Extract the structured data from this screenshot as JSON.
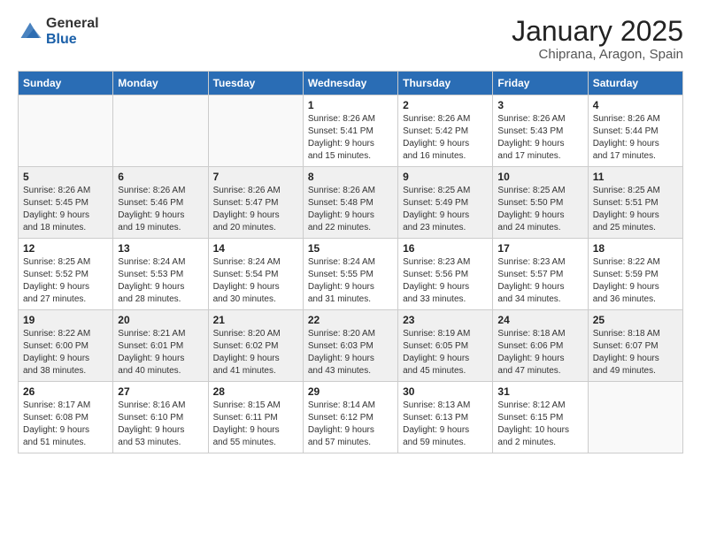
{
  "logo": {
    "general": "General",
    "blue": "Blue"
  },
  "header": {
    "month": "January 2025",
    "location": "Chiprana, Aragon, Spain"
  },
  "weekdays": [
    "Sunday",
    "Monday",
    "Tuesday",
    "Wednesday",
    "Thursday",
    "Friday",
    "Saturday"
  ],
  "weeks": [
    [
      {
        "day": "",
        "info": ""
      },
      {
        "day": "",
        "info": ""
      },
      {
        "day": "",
        "info": ""
      },
      {
        "day": "1",
        "info": "Sunrise: 8:26 AM\nSunset: 5:41 PM\nDaylight: 9 hours\nand 15 minutes."
      },
      {
        "day": "2",
        "info": "Sunrise: 8:26 AM\nSunset: 5:42 PM\nDaylight: 9 hours\nand 16 minutes."
      },
      {
        "day": "3",
        "info": "Sunrise: 8:26 AM\nSunset: 5:43 PM\nDaylight: 9 hours\nand 17 minutes."
      },
      {
        "day": "4",
        "info": "Sunrise: 8:26 AM\nSunset: 5:44 PM\nDaylight: 9 hours\nand 17 minutes."
      }
    ],
    [
      {
        "day": "5",
        "info": "Sunrise: 8:26 AM\nSunset: 5:45 PM\nDaylight: 9 hours\nand 18 minutes."
      },
      {
        "day": "6",
        "info": "Sunrise: 8:26 AM\nSunset: 5:46 PM\nDaylight: 9 hours\nand 19 minutes."
      },
      {
        "day": "7",
        "info": "Sunrise: 8:26 AM\nSunset: 5:47 PM\nDaylight: 9 hours\nand 20 minutes."
      },
      {
        "day": "8",
        "info": "Sunrise: 8:26 AM\nSunset: 5:48 PM\nDaylight: 9 hours\nand 22 minutes."
      },
      {
        "day": "9",
        "info": "Sunrise: 8:25 AM\nSunset: 5:49 PM\nDaylight: 9 hours\nand 23 minutes."
      },
      {
        "day": "10",
        "info": "Sunrise: 8:25 AM\nSunset: 5:50 PM\nDaylight: 9 hours\nand 24 minutes."
      },
      {
        "day": "11",
        "info": "Sunrise: 8:25 AM\nSunset: 5:51 PM\nDaylight: 9 hours\nand 25 minutes."
      }
    ],
    [
      {
        "day": "12",
        "info": "Sunrise: 8:25 AM\nSunset: 5:52 PM\nDaylight: 9 hours\nand 27 minutes."
      },
      {
        "day": "13",
        "info": "Sunrise: 8:24 AM\nSunset: 5:53 PM\nDaylight: 9 hours\nand 28 minutes."
      },
      {
        "day": "14",
        "info": "Sunrise: 8:24 AM\nSunset: 5:54 PM\nDaylight: 9 hours\nand 30 minutes."
      },
      {
        "day": "15",
        "info": "Sunrise: 8:24 AM\nSunset: 5:55 PM\nDaylight: 9 hours\nand 31 minutes."
      },
      {
        "day": "16",
        "info": "Sunrise: 8:23 AM\nSunset: 5:56 PM\nDaylight: 9 hours\nand 33 minutes."
      },
      {
        "day": "17",
        "info": "Sunrise: 8:23 AM\nSunset: 5:57 PM\nDaylight: 9 hours\nand 34 minutes."
      },
      {
        "day": "18",
        "info": "Sunrise: 8:22 AM\nSunset: 5:59 PM\nDaylight: 9 hours\nand 36 minutes."
      }
    ],
    [
      {
        "day": "19",
        "info": "Sunrise: 8:22 AM\nSunset: 6:00 PM\nDaylight: 9 hours\nand 38 minutes."
      },
      {
        "day": "20",
        "info": "Sunrise: 8:21 AM\nSunset: 6:01 PM\nDaylight: 9 hours\nand 40 minutes."
      },
      {
        "day": "21",
        "info": "Sunrise: 8:20 AM\nSunset: 6:02 PM\nDaylight: 9 hours\nand 41 minutes."
      },
      {
        "day": "22",
        "info": "Sunrise: 8:20 AM\nSunset: 6:03 PM\nDaylight: 9 hours\nand 43 minutes."
      },
      {
        "day": "23",
        "info": "Sunrise: 8:19 AM\nSunset: 6:05 PM\nDaylight: 9 hours\nand 45 minutes."
      },
      {
        "day": "24",
        "info": "Sunrise: 8:18 AM\nSunset: 6:06 PM\nDaylight: 9 hours\nand 47 minutes."
      },
      {
        "day": "25",
        "info": "Sunrise: 8:18 AM\nSunset: 6:07 PM\nDaylight: 9 hours\nand 49 minutes."
      }
    ],
    [
      {
        "day": "26",
        "info": "Sunrise: 8:17 AM\nSunset: 6:08 PM\nDaylight: 9 hours\nand 51 minutes."
      },
      {
        "day": "27",
        "info": "Sunrise: 8:16 AM\nSunset: 6:10 PM\nDaylight: 9 hours\nand 53 minutes."
      },
      {
        "day": "28",
        "info": "Sunrise: 8:15 AM\nSunset: 6:11 PM\nDaylight: 9 hours\nand 55 minutes."
      },
      {
        "day": "29",
        "info": "Sunrise: 8:14 AM\nSunset: 6:12 PM\nDaylight: 9 hours\nand 57 minutes."
      },
      {
        "day": "30",
        "info": "Sunrise: 8:13 AM\nSunset: 6:13 PM\nDaylight: 9 hours\nand 59 minutes."
      },
      {
        "day": "31",
        "info": "Sunrise: 8:12 AM\nSunset: 6:15 PM\nDaylight: 10 hours\nand 2 minutes."
      },
      {
        "day": "",
        "info": ""
      }
    ]
  ]
}
